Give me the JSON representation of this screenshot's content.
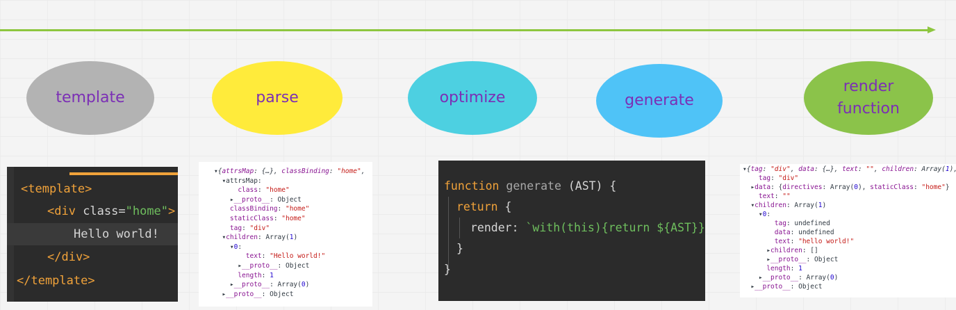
{
  "stages": [
    {
      "label": "template",
      "color": "#b3b3b3"
    },
    {
      "label": "parse",
      "color": "#ffeb3b"
    },
    {
      "label": "optimize",
      "color": "#4dd0e1"
    },
    {
      "label": "generate",
      "color": "#4fc3f7"
    },
    {
      "label": "render\nfunction",
      "color": "#8bc34a"
    }
  ],
  "colors": {
    "arrow": "#8dc63f",
    "label_text": "#7b2fb5",
    "code_bg": "#2b2b2b"
  },
  "template_code": {
    "open_template": "<template>",
    "div_open_tag": "<div",
    "div_attr": " class=",
    "div_attr_value": "\"home\"",
    "div_open_close": ">",
    "text": "Hello world!",
    "div_close": "</div>",
    "close_template": "</template>"
  },
  "parse_tree": {
    "rows": [
      "▾{attrsMap: {…}, classBinding: \"home\",",
      "  ▾attrsMap:",
      "      class: \"home\"",
      "    ▸__proto__: Object",
      "    classBinding: \"home\"",
      "    staticClass: \"home\"",
      "    tag: \"div\"",
      "  ▾children: Array(1)",
      "    ▾0:",
      "        text: \"Hello world!\"",
      "      ▸__proto__: Object",
      "      length: 1",
      "    ▸__proto__: Array(0)",
      "  ▸__proto__: Object"
    ]
  },
  "generate_code": {
    "kw_function": "function",
    "fn_name": " generate",
    "params": " (AST) {",
    "kw_return": "return",
    "return_brace": " {",
    "render_key": "render: ",
    "template_literal": "`with(this){return ${AST}}`,",
    "close_inner": "}",
    "close_outer": "}"
  },
  "render_tree": {
    "rows": [
      "▾{tag: \"div\", data: {…}, text: \"\", children: Array(1),",
      "    tag: \"div\"",
      "  ▸data: {directives: Array(0), staticClass: \"home\"}",
      "    text: \"\"",
      "  ▾children: Array(1)",
      "    ▾0:",
      "        tag: undefined",
      "        data: undefined",
      "        text: \"hello world!\"",
      "      ▸children: []",
      "      ▸__proto__: Object",
      "      length: 1",
      "    ▸__proto__: Array(0)",
      "  ▸__proto__: Object"
    ]
  }
}
